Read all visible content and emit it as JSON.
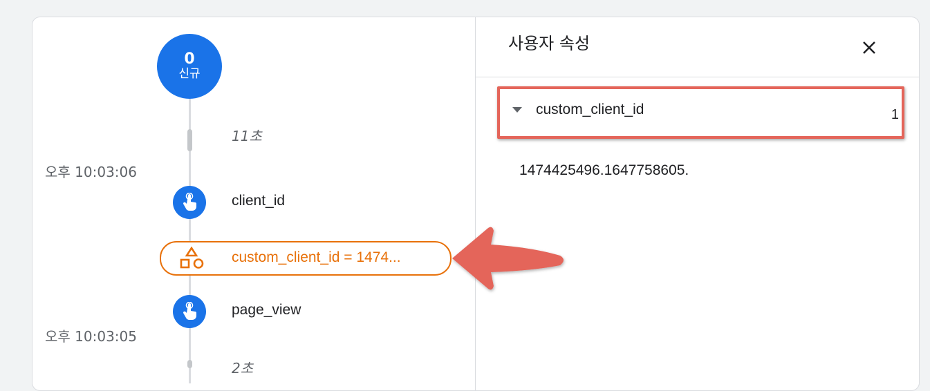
{
  "timeline": {
    "user_badge": {
      "count": "0",
      "label": "신규"
    },
    "durations": [
      "11초",
      "2초"
    ],
    "timestamps": [
      "오후 10:03:06",
      "오후 10:03:05"
    ],
    "events": [
      {
        "name": "client_id",
        "icon": "tap-icon"
      },
      {
        "name": "page_view",
        "icon": "tap-icon"
      }
    ],
    "user_property_pill": {
      "text": "custom_client_id = 1474...",
      "icon": "shapes-icon"
    }
  },
  "panel": {
    "title": "사용자 속성",
    "close_icon": "close-icon",
    "property": {
      "name": "custom_client_id",
      "count": "1",
      "value": "1474425496.1647758605."
    }
  },
  "colors": {
    "accent_blue": "#1a73e8",
    "property_orange": "#e8710a",
    "highlight_red": "#e4655a"
  }
}
